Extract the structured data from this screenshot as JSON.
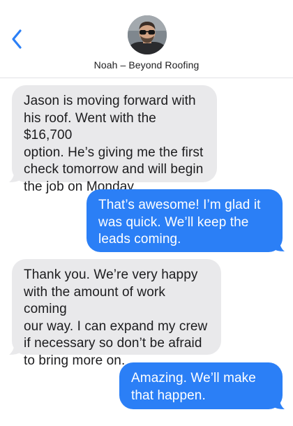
{
  "header": {
    "contact_name": "Noah – Beyond Roofing",
    "back_icon": "chevron-left-icon",
    "avatar_icon": "contact-avatar",
    "accent_color": "#2b7ff6"
  },
  "colors": {
    "incoming_bubble": "#e9e9eb",
    "outgoing_bubble": "#2b7ff6"
  },
  "messages": [
    {
      "direction": "incoming",
      "lines": [
        "Jason is moving forward with",
        "his roof. Went with the $16,700",
        "option. He’s giving me the first",
        "check tomorrow and will begin",
        "the job on Monday."
      ]
    },
    {
      "direction": "outgoing",
      "lines": [
        "That’s awesome! I’m glad it",
        "was quick. We’ll keep the",
        "leads coming."
      ]
    },
    {
      "direction": "incoming",
      "lines": [
        "Thank you. We’re very happy",
        "with the amount of work coming",
        "our way. I can expand my crew",
        "if necessary so don’t be afraid",
        "to bring more on."
      ]
    },
    {
      "direction": "outgoing",
      "lines": [
        "Amazing. We’ll make",
        "that happen."
      ]
    }
  ]
}
